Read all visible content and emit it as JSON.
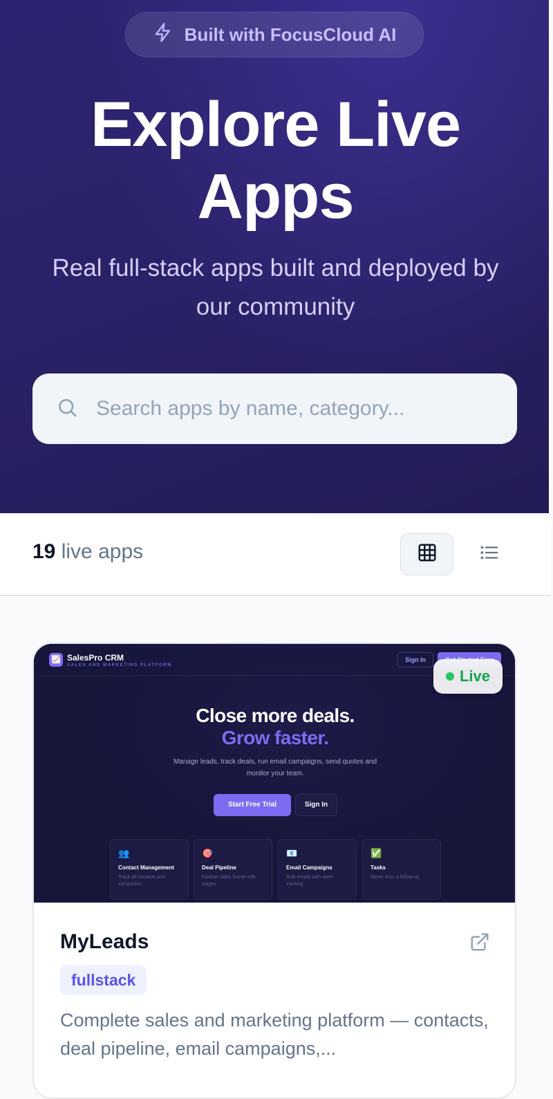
{
  "hero": {
    "badge": "Built with FocusCloud AI",
    "title_line1": "Explore Live",
    "title_line2": "Apps",
    "subtitle": "Real full-stack apps built and deployed by our community"
  },
  "search": {
    "placeholder": "Search apps by name, category..."
  },
  "toolbar": {
    "count": "19",
    "count_label": "live apps",
    "grid_view_icon": "grid-icon",
    "list_view_icon": "list-icon"
  },
  "card": {
    "status": "Live",
    "status_color": "#22c55e",
    "name": "MyLeads",
    "tag": "fullstack",
    "description": "Complete sales and marketing platform — contacts, deal pipeline, email campaigns,...",
    "external_icon": "external-link-icon",
    "preview": {
      "brand": "SalesPro CRM",
      "tagline": "SALES AND MARKETING PLATFORM",
      "sign_in": "Sign In",
      "get_started": "Get Started Free",
      "headline1": "Close more deals.",
      "headline2": "Grow faster.",
      "description": "Manage leads, track deals, run email campaigns, send quotes and monitor your team.",
      "primary_cta": "Start Free Trial",
      "secondary_cta": "Sign In",
      "features": [
        {
          "icon": "👥",
          "title": "Contact Management",
          "desc": "Track all contacts and companies"
        },
        {
          "icon": "🎯",
          "title": "Deal Pipeline",
          "desc": "Kanban sales funnel with stages"
        },
        {
          "icon": "📧",
          "title": "Email Campaigns",
          "desc": "Bulk emails with open tracking"
        },
        {
          "icon": "✅",
          "title": "Tasks",
          "desc": "Never miss a follow-up"
        }
      ]
    }
  },
  "colors": {
    "hero_bg": "#2a2268",
    "accent": "#7c6cf2",
    "tag_text": "#5b52e6"
  }
}
